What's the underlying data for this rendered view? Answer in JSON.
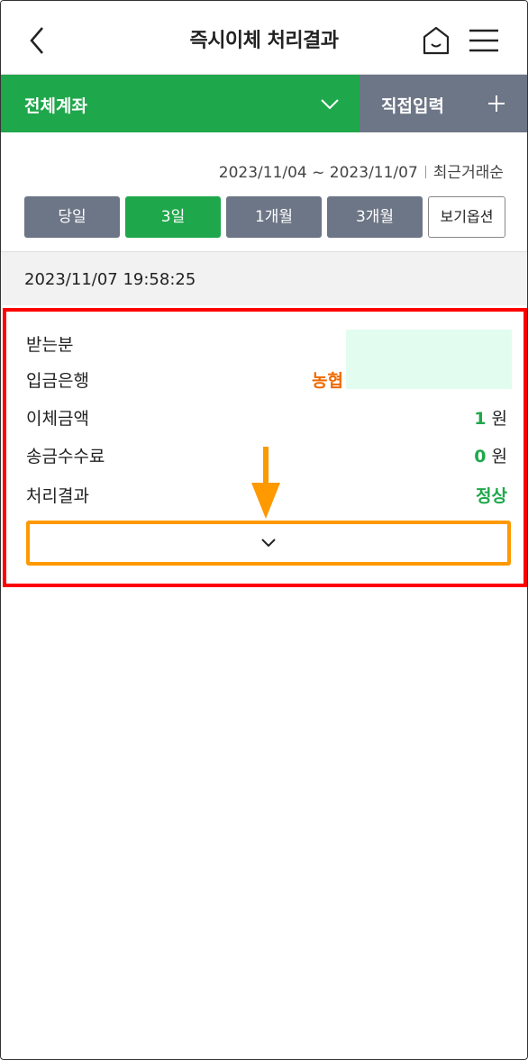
{
  "header": {
    "title": "즉시이체 처리결과",
    "back_icon": "chevron-left-icon",
    "home_icon": "home-icon",
    "menu_icon": "hamburger-menu-icon"
  },
  "account_bar": {
    "select_label": "전체계좌",
    "direct_input_label": "직접입력"
  },
  "filter": {
    "date_range": "2023/11/04 ~ 2023/11/07",
    "sort_label": "최근거래순",
    "periods": [
      "당일",
      "3일",
      "1개월",
      "3개월"
    ],
    "active_period": "3일",
    "option_label": "보기옵션"
  },
  "transaction": {
    "datetime": "2023/11/07 19:58:25",
    "rows": {
      "recipient": {
        "label": "받는분",
        "value": ""
      },
      "bank": {
        "label": "입금은행",
        "value": "농협"
      },
      "amount": {
        "label": "이체금액",
        "value": "1",
        "unit": "원"
      },
      "fee": {
        "label": "송금수수료",
        "value": "0",
        "unit": "원"
      },
      "result": {
        "label": "처리결과",
        "value": "정상"
      }
    }
  },
  "colors": {
    "green": "#1fa74b",
    "gray_button": "#6d7686",
    "orange": "#f06a00",
    "highlight_red": "#ff0000",
    "highlight_orange": "#ff9900"
  }
}
